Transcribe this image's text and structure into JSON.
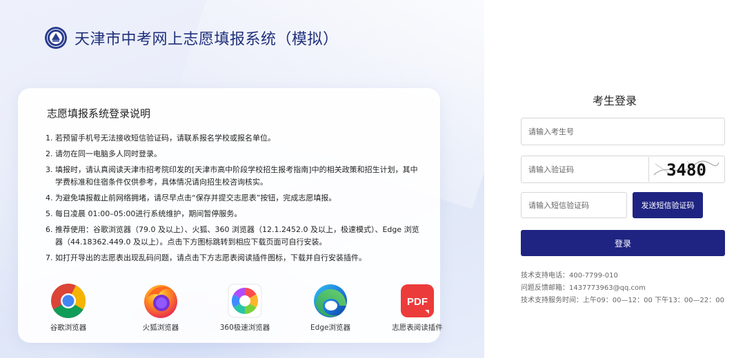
{
  "header": {
    "title": "天津市中考网上志愿填报系统（模拟）",
    "logo_icon": "seal-logo-icon"
  },
  "notice": {
    "title": "志愿填报系统登录说明",
    "items": [
      {
        "num": "1.",
        "text": "若预留手机号无法接收短信验证码，请联系报名学校或报名单位。"
      },
      {
        "num": "2.",
        "text": "请勿在同一电脑多人同时登录。"
      },
      {
        "num": "3.",
        "text": "填报时，请认真阅读天津市招考院印发的[天津市高中阶段学校招生报考指南]中的相关政策和招生计划，其中学费标准和住宿条件仅供参考，具体情况请向招生校咨询核实。"
      },
      {
        "num": "4.",
        "text": "为避免填报截止前网络拥堵，请尽早点击“保存并提交志愿表”按钮，完成志愿填报。"
      },
      {
        "num": "5.",
        "text": "每日凌晨 01:00–05:00进行系统维护，期间暂停服务。"
      },
      {
        "num": "6.",
        "text": "推荐使用：谷歌浏览器（79.0 及以上）、火狐、360 浏览器（12.1.2452.0 及以上，极速模式）、Edge 浏览器（44.18362.449.0 及以上）。点击下方图标跳转到相应下载页面可自行安装。"
      },
      {
        "num": "7.",
        "text": "如打开导出的志愿表出现乱码问题，请点击下方志愿表阅读插件图标，下载并自行安装插件。"
      }
    ],
    "browsers": [
      {
        "label": "谷歌浏览器",
        "icon": "chrome-icon"
      },
      {
        "label": "火狐浏览器",
        "icon": "firefox-icon"
      },
      {
        "label": "360极速浏览器",
        "icon": "360-browser-icon"
      },
      {
        "label": "Edge浏览器",
        "icon": "edge-icon"
      },
      {
        "label": "志愿表阅读插件",
        "icon": "pdf-icon",
        "icon_text": "PDF"
      }
    ]
  },
  "login": {
    "title": "考生登录",
    "candidate_placeholder": "请输入考生号",
    "captcha_placeholder": "请输入验证码",
    "captcha_text": "3480",
    "sms_placeholder": "请输入短信验证码",
    "sms_button": "发送短信验证码",
    "login_button": "登录",
    "accent_color": "#1f2482"
  },
  "support": {
    "phone": "技术支持电话：400-7799-010",
    "email": "问题反馈邮箱：1437773963@qq.com",
    "hours": "技术支持服务时间：上午09：00—12：00 下午13：00—22：00"
  }
}
